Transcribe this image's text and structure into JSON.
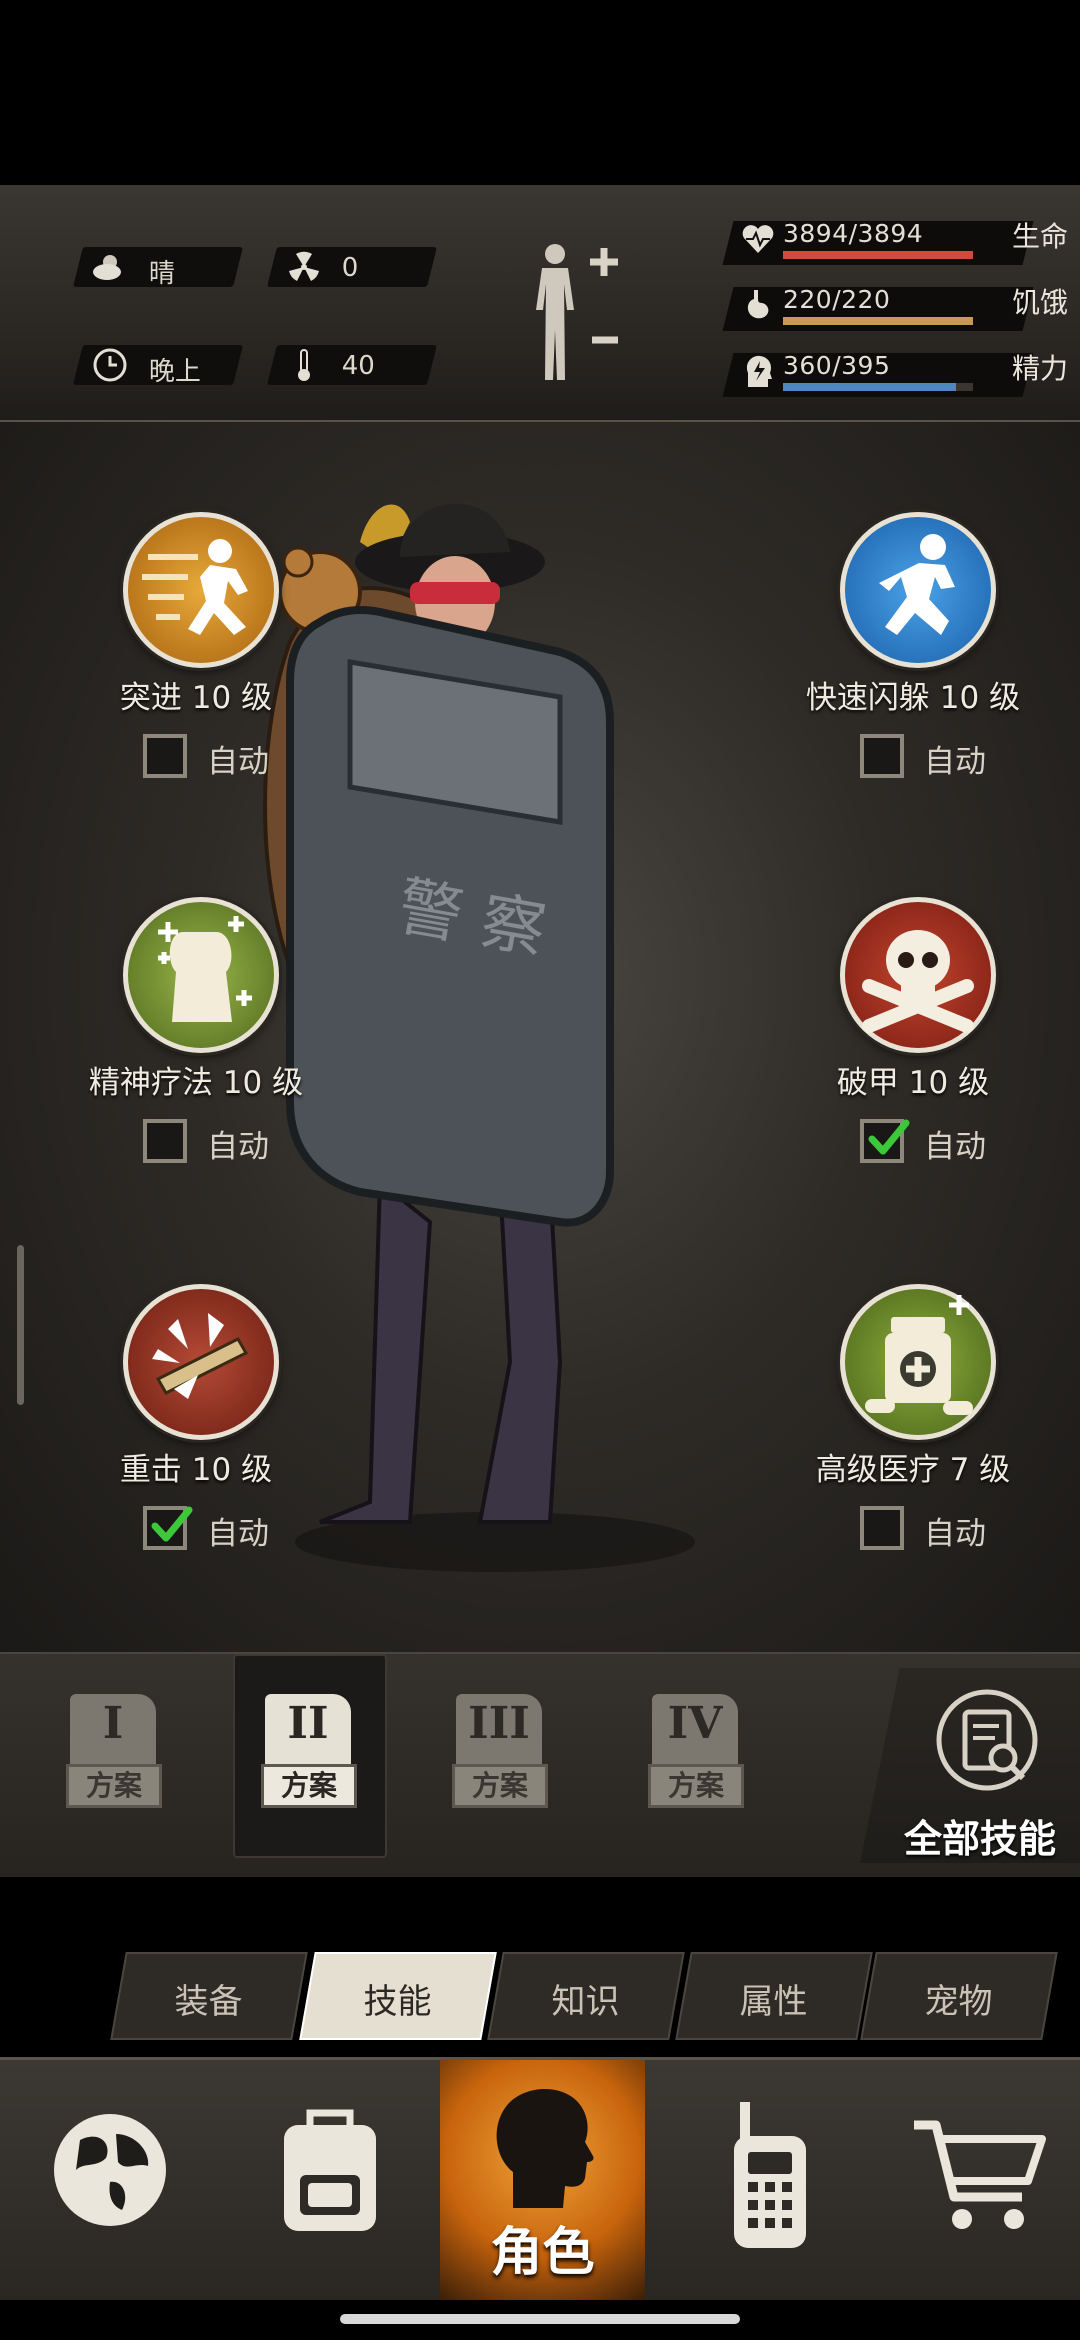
{
  "status": {
    "weather": "晴",
    "radiation": "0",
    "time_of_day": "晚上",
    "temperature": "40",
    "vitals": [
      {
        "label": "生命",
        "value": "3894/3894",
        "level": 1.0,
        "color": "#d24a3c",
        "icon": "heart-icon"
      },
      {
        "label": "饥饿",
        "value": "220/220",
        "level": 1.0,
        "color": "#c99a55",
        "icon": "stomach-icon"
      },
      {
        "label": "精力",
        "value": "360/395",
        "level": 0.91,
        "color": "#4f86c4",
        "icon": "energy-head-icon"
      }
    ]
  },
  "skills": [
    {
      "name": "突进 10 级",
      "auto_label": "自动",
      "auto_checked": false,
      "icon": "dash-icon"
    },
    {
      "name": "快速闪躲 10 级",
      "auto_label": "自动",
      "auto_checked": false,
      "icon": "dodge-icon"
    },
    {
      "name": "精神疗法 10 级",
      "auto_label": "自动",
      "auto_checked": false,
      "icon": "psychotherapy-icon"
    },
    {
      "name": "破甲 10 级",
      "auto_label": "自动",
      "auto_checked": true,
      "icon": "skull-crossbones-icon"
    },
    {
      "name": "重击 10 级",
      "auto_label": "自动",
      "auto_checked": true,
      "icon": "heavy-strike-icon"
    },
    {
      "name": "高级医疗 7 级",
      "auto_label": "自动",
      "auto_checked": false,
      "icon": "medkit-icon"
    }
  ],
  "plans": [
    {
      "numeral": "I",
      "label": "方案",
      "active": false
    },
    {
      "numeral": "II",
      "label": "方案",
      "active": true
    },
    {
      "numeral": "III",
      "label": "方案",
      "active": false
    },
    {
      "numeral": "IV",
      "label": "方案",
      "active": false
    }
  ],
  "all_skills_label": "全部技能",
  "tabs": [
    {
      "label": "装备",
      "active": false
    },
    {
      "label": "技能",
      "active": true
    },
    {
      "label": "知识",
      "active": false
    },
    {
      "label": "属性",
      "active": false
    },
    {
      "label": "宠物",
      "active": false
    }
  ],
  "nav": {
    "map_icon": "globe-icon",
    "bag_icon": "backpack-icon",
    "role_label": "角色",
    "radio_icon": "walkie-talkie-icon",
    "shop_icon": "shopping-cart-icon"
  },
  "colors": {
    "accent_orange": "#e08a20",
    "check_green": "#3cc83a"
  }
}
